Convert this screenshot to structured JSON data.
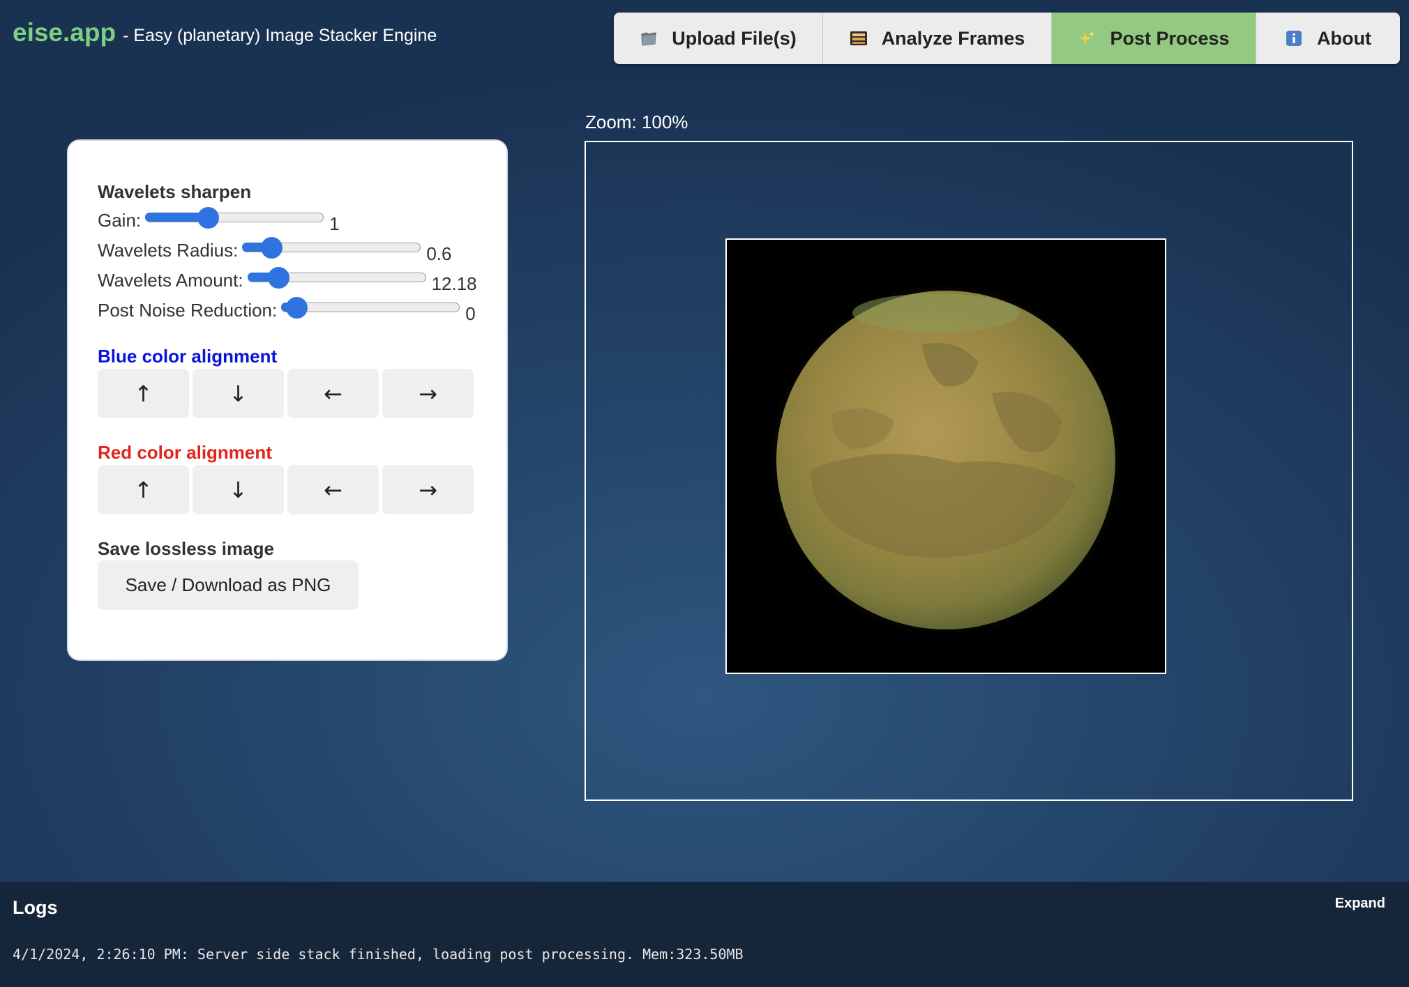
{
  "header": {
    "brand_name": "eise.app",
    "tagline": "- Easy (planetary) Image Stacker Engine"
  },
  "nav": {
    "tabs": [
      {
        "label": "Upload File(s)",
        "icon": "folder-icon"
      },
      {
        "label": "Analyze Frames",
        "icon": "film-frames-icon"
      },
      {
        "label": "Post Process",
        "icon": "sparkles-icon",
        "active": true
      },
      {
        "label": "About",
        "icon": "info-icon"
      }
    ],
    "active_color": "#93c981"
  },
  "panel": {
    "wavelets_title": "Wavelets sharpen",
    "sliders": [
      {
        "label": "Gain:",
        "value": "1",
        "position": 0.35
      },
      {
        "label": "Wavelets Radius:",
        "value": "0.6",
        "position": 0.16
      },
      {
        "label": "Wavelets Amount:",
        "value": "12.18",
        "position": 0.17
      },
      {
        "label": "Post Noise Reduction:",
        "value": "0",
        "position": 0.08
      }
    ],
    "blue_title": "Blue color alignment",
    "red_title": "Red color alignment",
    "arrows": {
      "up": "↑",
      "down": "↓",
      "left": "←",
      "right": "→"
    },
    "save_title": "Save lossless image",
    "save_button": "Save / Download as PNG"
  },
  "viewer": {
    "zoom_label": "Zoom: 100%"
  },
  "logs": {
    "title": "Logs",
    "expand": "Expand",
    "entries": [
      "4/1/2024, 2:26:10 PM: Server side stack finished, loading post processing. Mem:323.50MB"
    ]
  },
  "colors": {
    "brand": "#7dcf82",
    "slider": "#2f73e0",
    "blue_heading": "#0a14d8",
    "red_heading": "#e0251c"
  }
}
